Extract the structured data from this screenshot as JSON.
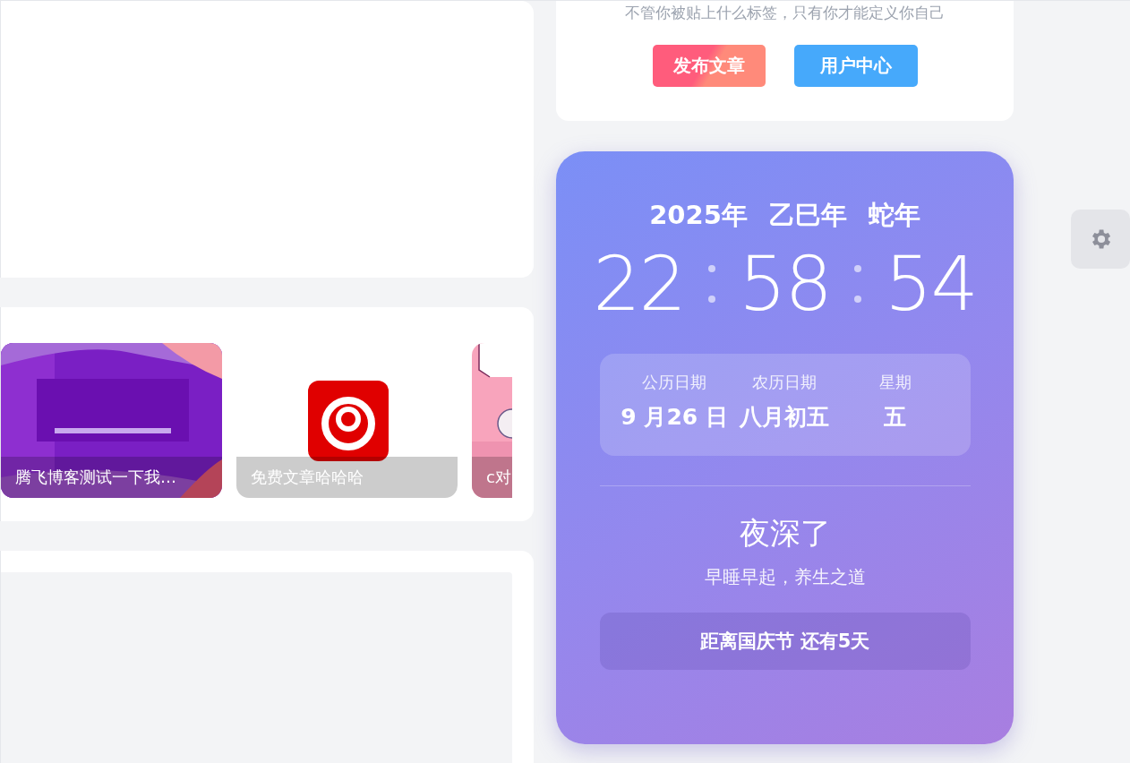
{
  "profile_card": {
    "motto": "不管你被贴上什么标签，只有你才能定义你自己",
    "buttons": [
      {
        "label": "发布文章",
        "kind": "primary"
      },
      {
        "label": "用户中心",
        "kind": "secondary"
      }
    ]
  },
  "carousel": {
    "items": [
      {
        "caption": "腾飞博客测试一下我…",
        "kind": "purple"
      },
      {
        "caption": "免费文章哈哈哈",
        "kind": "logo"
      },
      {
        "caption": "c对",
        "kind": "pink"
      }
    ]
  },
  "clock_card": {
    "year": [
      "2025年",
      "乙巳年",
      "蛇年"
    ],
    "time": [
      "22",
      "58",
      "54"
    ],
    "dates": [
      {
        "label": "公历日期",
        "value": "9 月26 日"
      },
      {
        "label": "农历日期",
        "value": "八月初五"
      },
      {
        "label": "星期",
        "value": "五"
      }
    ],
    "greeting": "夜深了",
    "tip": "早睡早起，养生之道",
    "countdown": "距离国庆节 还有5天"
  }
}
